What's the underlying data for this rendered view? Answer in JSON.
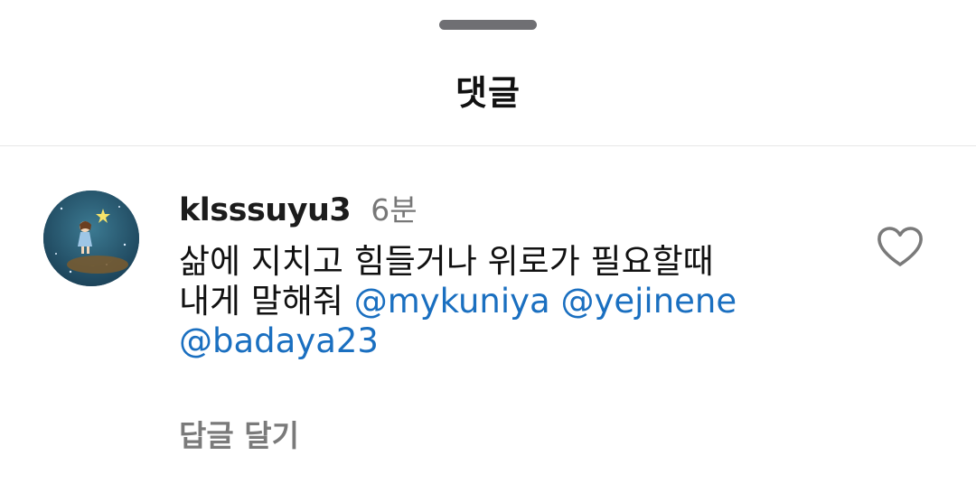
{
  "sheet": {
    "title": "댓글"
  },
  "comment": {
    "username": "klsssuyu3",
    "time": "6분",
    "text_line1": "삶에 지치고 힘들거나 위로가 필요할때",
    "text_line2_prefix": "내게 말해줘",
    "mentions": [
      "@mykuniya",
      "@yejinene",
      "@badaya23"
    ],
    "reply_label": "답글 달기",
    "like_icon": "heart-outline-icon",
    "avatar_icon": "moon-girl-avatar"
  },
  "colors": {
    "mention": "#1a6fc0",
    "secondary_text": "#777777",
    "handle": "#6f6f73",
    "divider": "#e6e6e6"
  }
}
